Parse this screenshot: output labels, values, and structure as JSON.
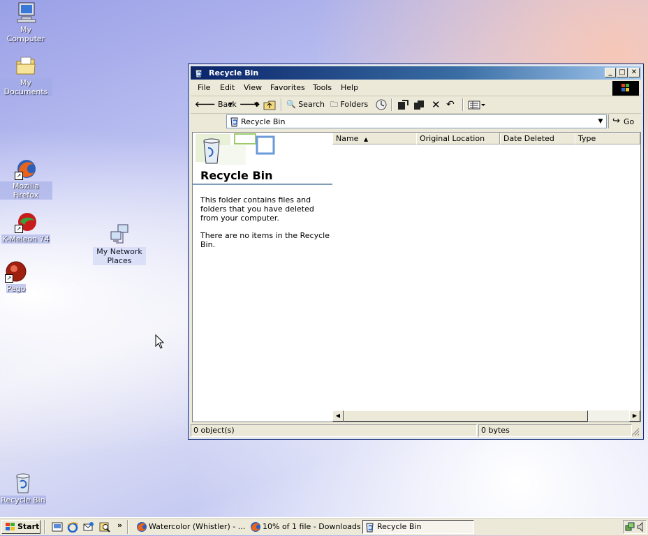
{
  "desktop": {
    "icons": [
      {
        "label": "My Computer"
      },
      {
        "label": "My Documents"
      },
      {
        "label": "Mozilla Firefox"
      },
      {
        "label": "K-Meleon 74"
      },
      {
        "label": "Pego"
      },
      {
        "label": "My Network Places"
      },
      {
        "label": "Recycle Bin"
      }
    ]
  },
  "window": {
    "title": "Recycle Bin",
    "menu": [
      "File",
      "Edit",
      "View",
      "Favorites",
      "Tools",
      "Help"
    ],
    "toolbar": {
      "back": "Back",
      "search": "Search",
      "folders": "Folders"
    },
    "address": {
      "value": "Recycle Bin",
      "go": "Go"
    },
    "left_pane": {
      "title": "Recycle Bin",
      "description": "This folder contains files and folders that you have deleted from your computer.",
      "empty_message": "There are no items in the Recycle Bin."
    },
    "columns": [
      "Name",
      "Original Location",
      "Date Deleted",
      "Type"
    ],
    "status": {
      "objects": "0 object(s)",
      "size": "0 bytes"
    }
  },
  "taskbar": {
    "start": "Start",
    "tasks": [
      {
        "label": "Watercolor (Whistler) - ..."
      },
      {
        "label": "10% of 1 file - Downloads"
      },
      {
        "label": "Recycle Bin"
      }
    ],
    "overflow": "»"
  },
  "colors": {
    "title_bar_start": "#0a246a",
    "title_bar_end": "#a6caf0",
    "window_face": "#ece9d8"
  }
}
